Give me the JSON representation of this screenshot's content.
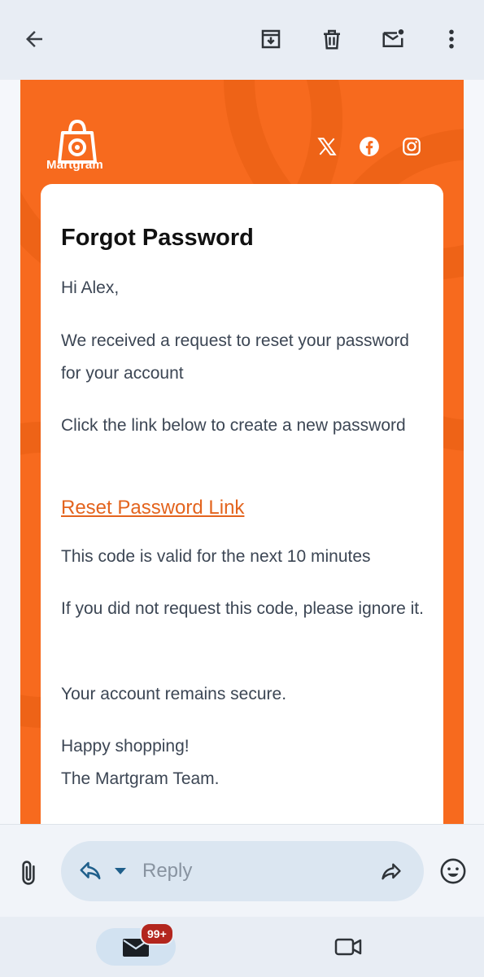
{
  "toolbar": {
    "back_icon": "arrow-left-icon",
    "archive_icon": "archive-icon",
    "delete_icon": "trash-icon",
    "mark_unread_icon": "mark-unread-icon",
    "more_icon": "more-vert-icon"
  },
  "email": {
    "brand": {
      "logo_text": "Martgram",
      "social_icons": [
        "x-icon",
        "facebook-icon",
        "instagram-icon"
      ],
      "accent_color": "#f76a1e"
    },
    "title": "Forgot Password",
    "greeting": "Hi Alex,",
    "para1": "We received a request to reset your password for your account",
    "para2": "Click the link below to create a new password",
    "link_text": "Reset Password Link",
    "para3": "This code is valid for the next 10 minutes",
    "para4": "If you did not request this code, please ignore it.",
    "para5": "Your account remains secure.",
    "signoff1": "Happy shopping!",
    "signoff2": "The Martgram Team."
  },
  "replybar": {
    "attach_icon": "paperclip-icon",
    "reply_icon": "reply-icon",
    "placeholder": "Reply",
    "forward_icon": "forward-icon",
    "emoji_icon": "emoji-icon"
  },
  "bottomnav": {
    "mail_badge": "99+",
    "mail_icon": "mail-icon",
    "meet_icon": "video-icon"
  }
}
